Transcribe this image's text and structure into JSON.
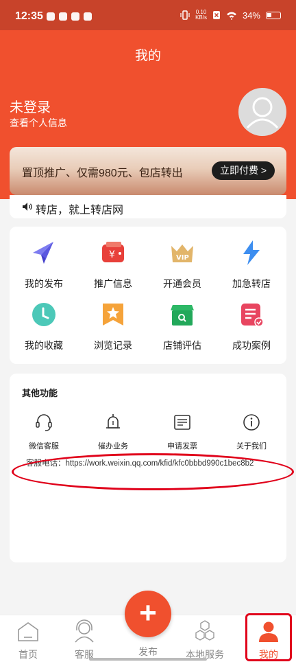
{
  "status_bar": {
    "time": "12:35",
    "net_speed_top": "0.10",
    "net_speed_bottom": "KB/s",
    "battery": "34%"
  },
  "page": {
    "title": "我的"
  },
  "user": {
    "name": "未登录",
    "subtitle": "查看个人信息"
  },
  "promo": {
    "text": "置顶推广、仅需980元、包店转出",
    "button_label": "立即付费 >"
  },
  "notice": {
    "text": "转店，就上转店网"
  },
  "grid": {
    "items": [
      {
        "label": "我的发布",
        "icon": "paper-plane-icon"
      },
      {
        "label": "推广信息",
        "icon": "wallet-icon"
      },
      {
        "label": "开通会员",
        "icon": "vip-crown-icon"
      },
      {
        "label": "加急转店",
        "icon": "lightning-icon"
      },
      {
        "label": "我的收藏",
        "icon": "clock-icon"
      },
      {
        "label": "浏览记录",
        "icon": "star-bookmark-icon"
      },
      {
        "label": "店铺评估",
        "icon": "shop-search-icon"
      },
      {
        "label": "成功案例",
        "icon": "document-check-icon"
      }
    ]
  },
  "other": {
    "title": "其他功能",
    "items": [
      {
        "label": "微信客服",
        "icon": "headset-icon"
      },
      {
        "label": "催办业务",
        "icon": "bell-icon"
      },
      {
        "label": "申请发票",
        "icon": "invoice-icon"
      },
      {
        "label": "关于我们",
        "icon": "info-icon"
      }
    ],
    "phone_line": "客服电话：https://work.weixin.qq.com/kfid/kfc0bbbd990c1bec8b2"
  },
  "tabbar": {
    "items": [
      {
        "label": "首页",
        "icon": "home-icon"
      },
      {
        "label": "客服",
        "icon": "customer-service-icon"
      },
      {
        "label": "发布",
        "icon": "plus-icon"
      },
      {
        "label": "本地服务",
        "icon": "hexagons-icon"
      },
      {
        "label": "我的",
        "icon": "person-icon"
      }
    ],
    "active": "我的"
  },
  "colors": {
    "brand": "#f0502e",
    "status_bar": "#c8432a",
    "annotation": "#e0001a"
  }
}
